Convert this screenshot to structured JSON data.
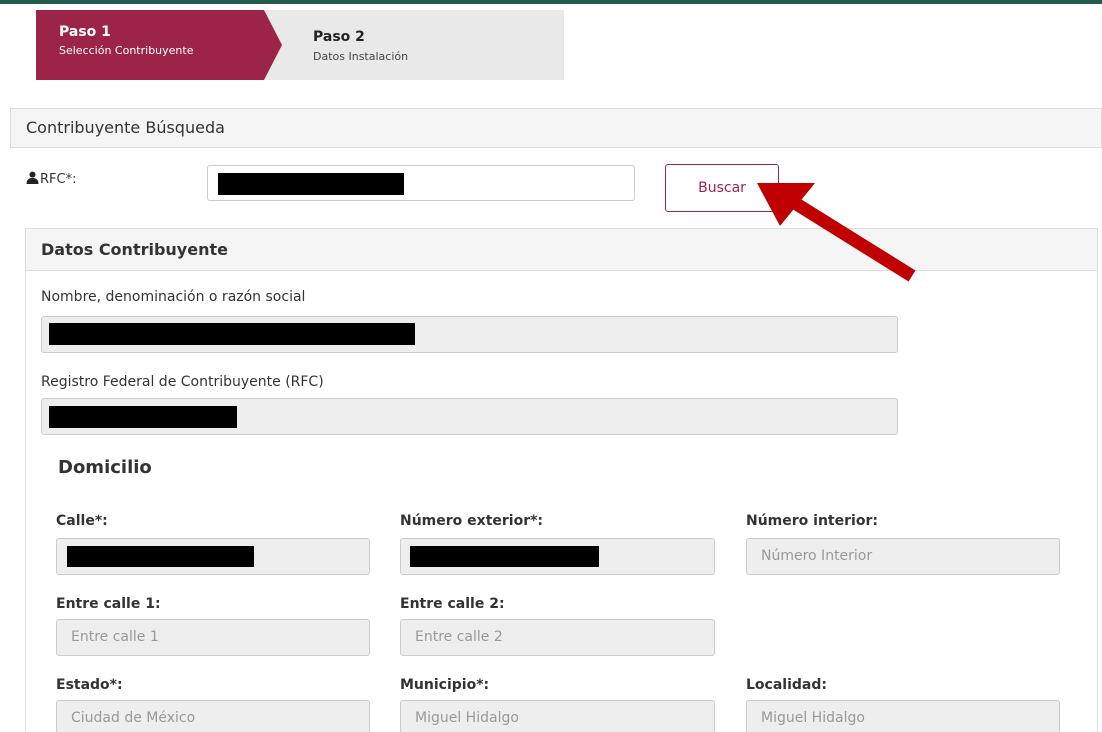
{
  "stepper": {
    "step1": {
      "title": "Paso 1",
      "subtitle": "Selección Contribuyente"
    },
    "step2": {
      "title": "Paso 2",
      "subtitle": "Datos Instalación"
    }
  },
  "search_panel": {
    "title": "Contribuyente Búsqueda",
    "rfc_label": "RFC*:",
    "search_button": "Buscar"
  },
  "taxpayer_panel": {
    "title": "Datos Contribuyente",
    "name_label": "Nombre, denominación o razón social",
    "rfc_label": "Registro Federal de Contribuyente (RFC)"
  },
  "address": {
    "title": "Domicilio",
    "calle_label": "Calle*:",
    "num_ext_label": "Número exterior*:",
    "num_int_label": "Número interior:",
    "num_int_placeholder": "Número Interior",
    "entre1_label": "Entre calle 1:",
    "entre1_placeholder": "Entre calle 1",
    "entre2_label": "Entre calle 2:",
    "entre2_placeholder": "Entre calle 2",
    "estado_label": "Estado*:",
    "estado_value": "Ciudad de México",
    "municipio_label": "Municipio*:",
    "municipio_value": "Miguel Hidalgo",
    "localidad_label": "Localidad:",
    "localidad_value": "Miguel Hidalgo"
  },
  "colors": {
    "brand": "#9d2449",
    "accent_line": "#235b4e",
    "annotation_arrow": "#c00000"
  },
  "icons": {
    "rfc": "user-icon",
    "annotation": "red-arrow-icon"
  }
}
